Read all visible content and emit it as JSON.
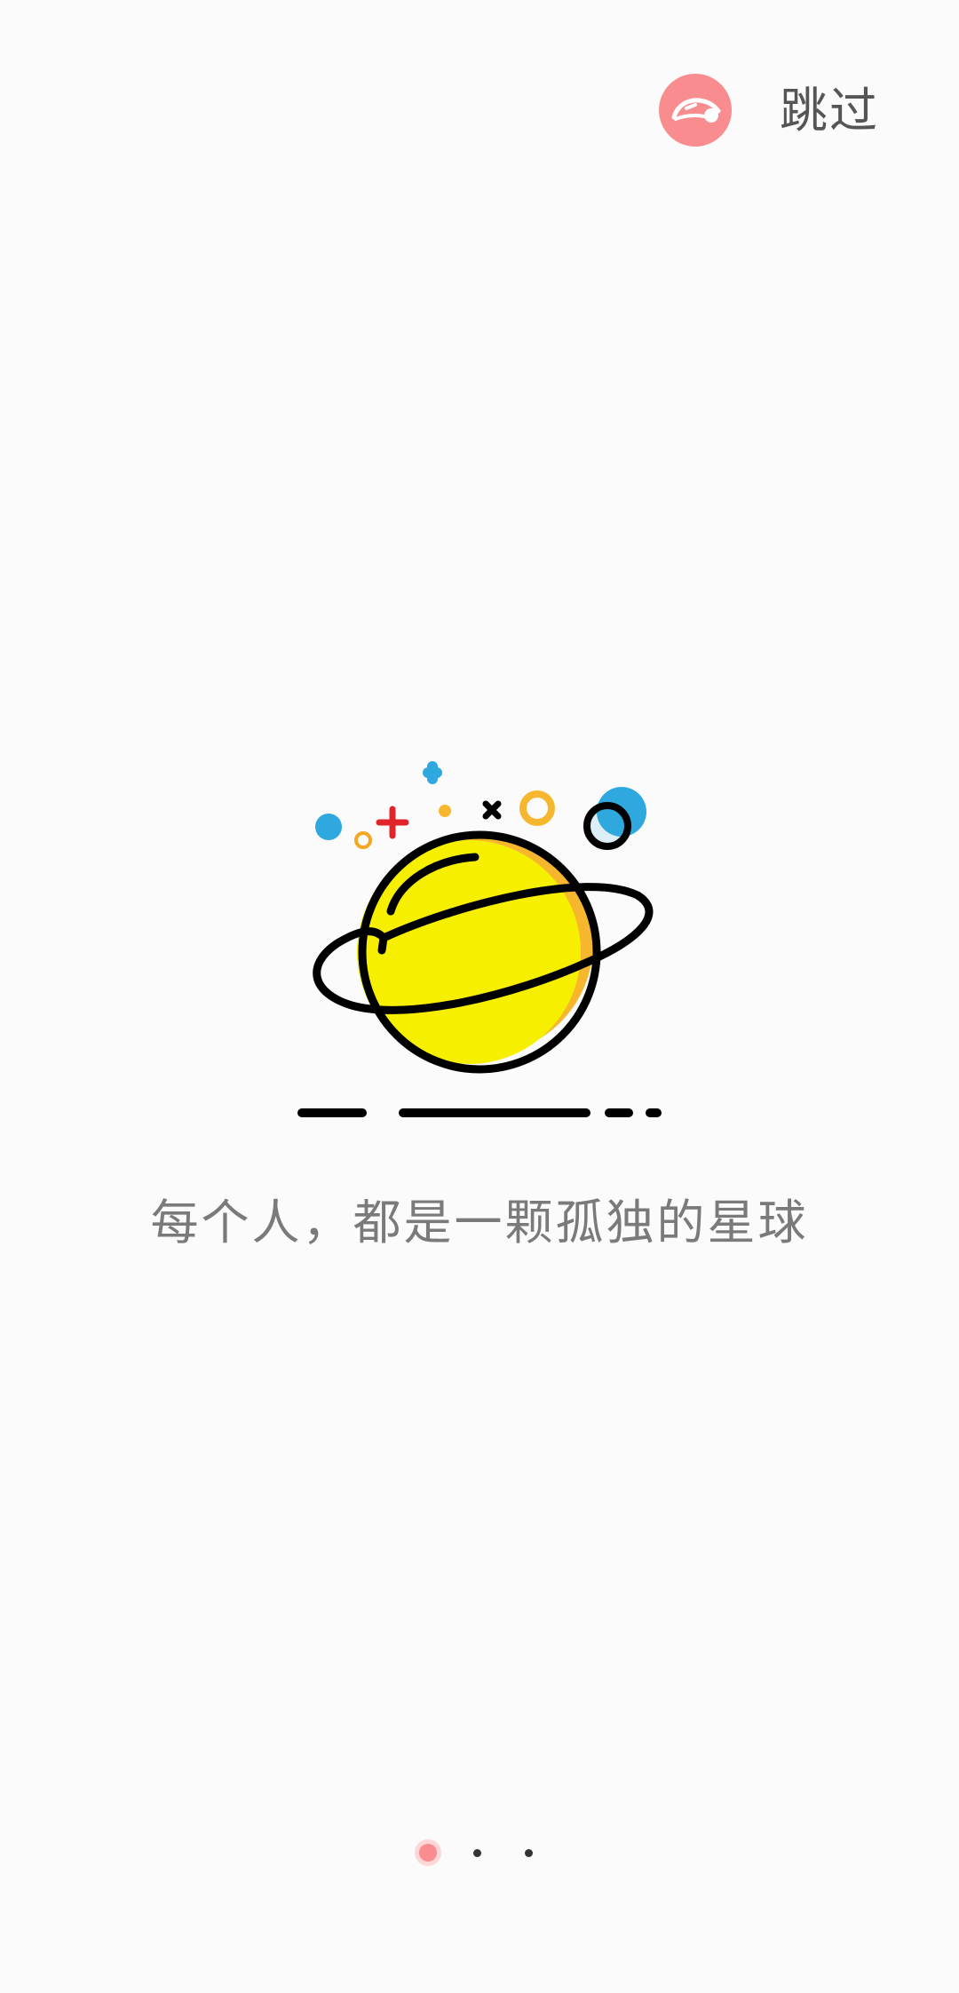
{
  "header": {
    "logo_icon": "app-logo-icon",
    "skip_label": "跳过"
  },
  "onboarding": {
    "illustration": "planet-illustration",
    "tagline": "每个人，都是一颗孤独的星球"
  },
  "pager": {
    "total_pages": 3,
    "active_page": 1
  },
  "colors": {
    "accent": "#f98c8f",
    "planet": "#f7ef00",
    "planet_shadow": "#f6b72e",
    "blue": "#2fa8df",
    "red": "#e0242a",
    "text": "#7a7a7a"
  }
}
